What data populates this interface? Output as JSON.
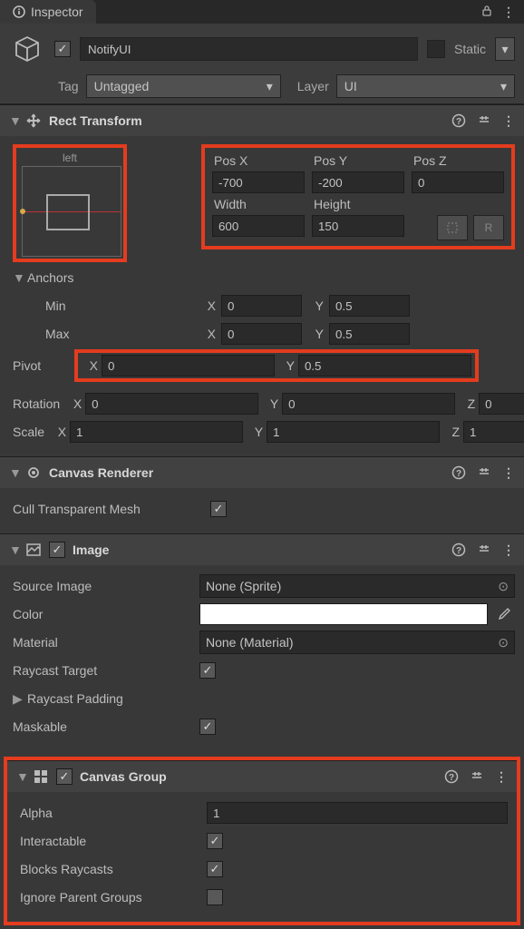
{
  "tab": {
    "title": "Inspector"
  },
  "header": {
    "name": "NotifyUI",
    "enabled": true,
    "static_label": "Static",
    "tag_label": "Tag",
    "tag_value": "Untagged",
    "layer_label": "Layer",
    "layer_value": "UI"
  },
  "rect_transform": {
    "title": "Rect Transform",
    "anchor_h": "left",
    "anchor_v": "middle",
    "posx_label": "Pos X",
    "posx": "-700",
    "posy_label": "Pos Y",
    "posy": "-200",
    "posz_label": "Pos Z",
    "posz": "0",
    "width_label": "Width",
    "width": "600",
    "height_label": "Height",
    "height": "150",
    "r_btn": "R",
    "anchors_label": "Anchors",
    "min_label": "Min",
    "min_x": "0",
    "min_y": "0.5",
    "max_label": "Max",
    "max_x": "0",
    "max_y": "0.5",
    "pivot_label": "Pivot",
    "pivot_x": "0",
    "pivot_y": "0.5",
    "rotation_label": "Rotation",
    "rot_x": "0",
    "rot_y": "0",
    "rot_z": "0",
    "scale_label": "Scale",
    "scale_x": "1",
    "scale_y": "1",
    "scale_z": "1"
  },
  "canvas_renderer": {
    "title": "Canvas Renderer",
    "cull_label": "Cull Transparent Mesh",
    "cull": true
  },
  "image": {
    "title": "Image",
    "enabled": true,
    "source_label": "Source Image",
    "source_value": "None (Sprite)",
    "color_label": "Color",
    "color_value": "#ffffff",
    "material_label": "Material",
    "material_value": "None (Material)",
    "raycast_label": "Raycast Target",
    "raycast": true,
    "raycast_padding_label": "Raycast Padding",
    "maskable_label": "Maskable",
    "maskable": true
  },
  "canvas_group": {
    "title": "Canvas Group",
    "enabled": true,
    "alpha_label": "Alpha",
    "alpha": "1",
    "interactable_label": "Interactable",
    "interactable": true,
    "blocks_label": "Blocks Raycasts",
    "blocks": true,
    "ignore_label": "Ignore Parent Groups",
    "ignore": false
  },
  "axis": {
    "x": "X",
    "y": "Y",
    "z": "Z"
  }
}
